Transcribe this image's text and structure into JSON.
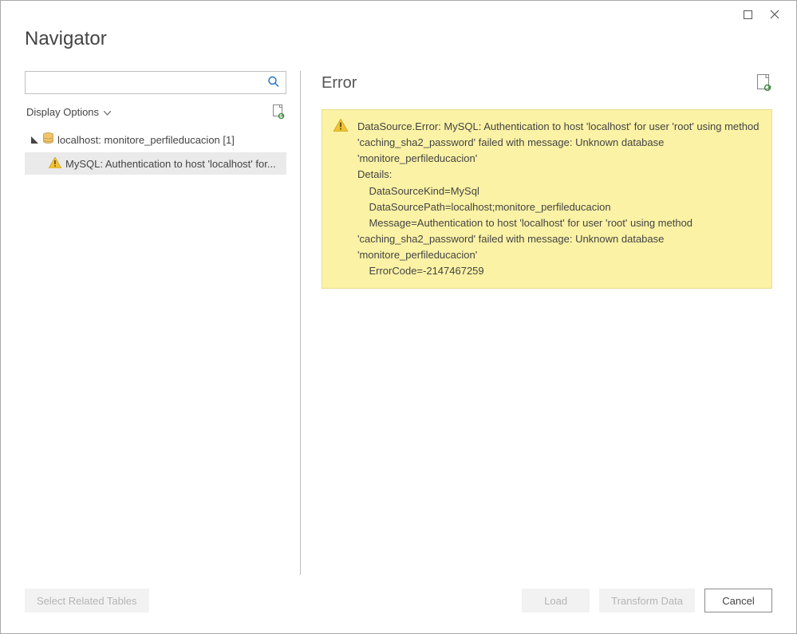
{
  "title": "Navigator",
  "search": {
    "placeholder": ""
  },
  "displayOptions": {
    "label": "Display Options"
  },
  "tree": {
    "root": {
      "label": "localhost: monitore_perfileducacion [1]"
    },
    "child": {
      "label": "MySQL: Authentication to host 'localhost' for..."
    }
  },
  "right": {
    "title": "Error",
    "error": "DataSource.Error: MySQL: Authentication to host 'localhost' for user 'root' using method 'caching_sha2_password' failed with message: Unknown database 'monitore_perfileducacion'\nDetails:\n    DataSourceKind=MySql\n    DataSourcePath=localhost;monitore_perfileducacion\n    Message=Authentication to host 'localhost' for user 'root' using method 'caching_sha2_password' failed with message: Unknown database 'monitore_perfileducacion'\n    ErrorCode=-2147467259"
  },
  "footer": {
    "selectRelated": "Select Related Tables",
    "load": "Load",
    "transform": "Transform Data",
    "cancel": "Cancel"
  }
}
